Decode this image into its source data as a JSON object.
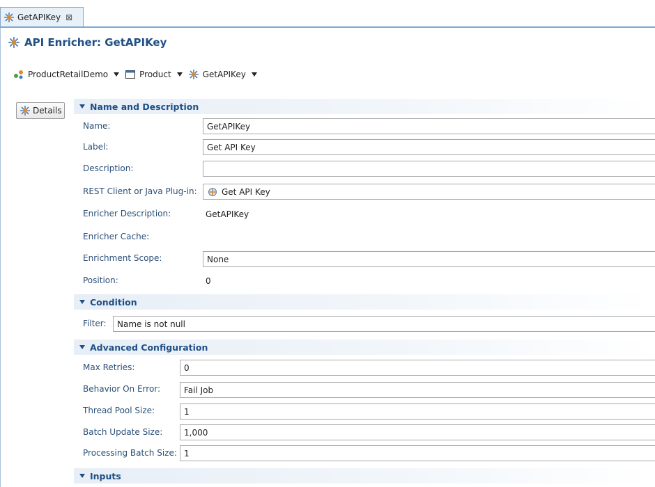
{
  "tab": {
    "label": "GetAPIKey",
    "close": "⊠"
  },
  "header": {
    "title": "API Enricher: GetAPIKey"
  },
  "breadcrumb": [
    {
      "label": "ProductRetailDemo",
      "icon": "project-icon"
    },
    {
      "label": "Product",
      "icon": "entity-window-icon"
    },
    {
      "label": "GetAPIKey",
      "icon": "enricher-icon"
    }
  ],
  "details_button": {
    "label": "Details"
  },
  "sections": {
    "name_description": {
      "title": "Name and Description",
      "name": {
        "label": "Name:",
        "value": "GetAPIKey"
      },
      "label": {
        "label": "Label:",
        "value": "Get API Key"
      },
      "description": {
        "label": "Description:",
        "value": ""
      },
      "rest_client": {
        "label": "REST Client or Java Plug-in:",
        "value": "Get API Key"
      },
      "enricher_description": {
        "label": "Enricher Description:",
        "value": "GetAPIKey"
      },
      "enricher_cache": {
        "label": "Enricher Cache:"
      },
      "enrichment_scope": {
        "label": "Enrichment Scope:",
        "value": "None"
      },
      "position": {
        "label": "Position:",
        "value": "0"
      }
    },
    "condition": {
      "title": "Condition",
      "filter": {
        "label": "Filter:",
        "value": "Name is not null"
      }
    },
    "advanced": {
      "title": "Advanced Configuration",
      "max_retries": {
        "label": "Max Retries:",
        "value": "0"
      },
      "behavior_on_error": {
        "label": "Behavior On Error:",
        "value": "Fail Job"
      },
      "thread_pool_size": {
        "label": "Thread Pool Size:",
        "value": "1"
      },
      "batch_update_size": {
        "label": "Batch Update Size:",
        "value": "1,000"
      },
      "processing_batch_size": {
        "label": "Processing Batch Size:",
        "value": "1"
      }
    },
    "inputs": {
      "title": "Inputs"
    }
  },
  "colors": {
    "accent": "#1f4f86",
    "label_text": "#2b4f78",
    "tab_border": "#7ca7d2"
  }
}
